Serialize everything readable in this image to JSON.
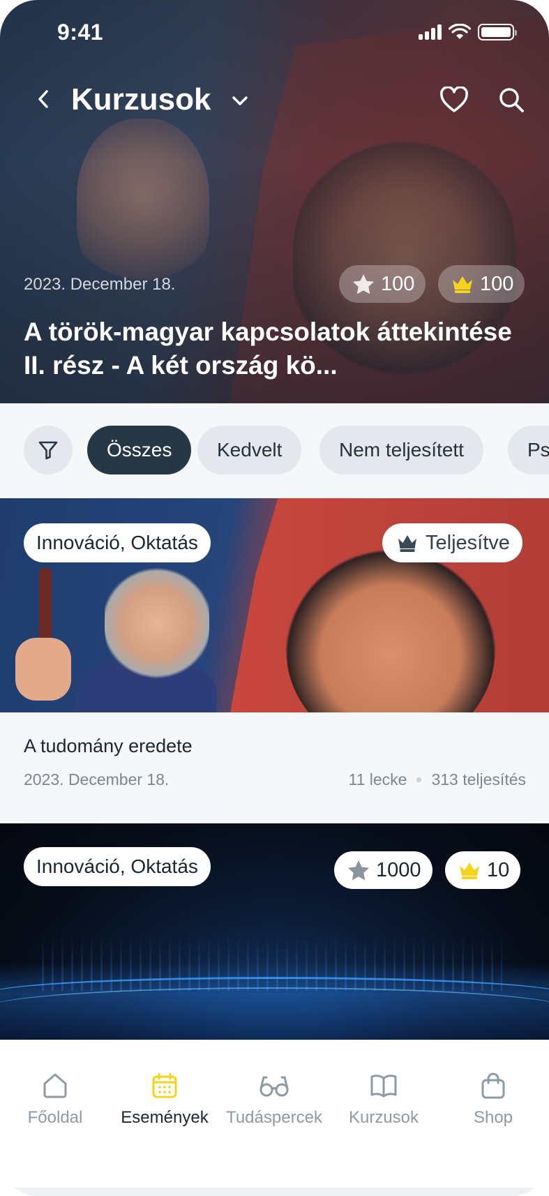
{
  "status_bar": {
    "time": "9:41"
  },
  "header": {
    "title": "Kurzusok"
  },
  "hero": {
    "date": "2023. December 18.",
    "stars": "100",
    "crowns": "100",
    "title": "A török-magyar kapcsolatok áttekintése II. rész - A két ország kö..."
  },
  "filters": {
    "chips": [
      "Összes",
      "Kedvelt",
      "Nem teljesített",
      "Ps"
    ],
    "active": "Összes"
  },
  "cards": [
    {
      "tags": "Innováció, Oktatás",
      "status": "Teljesítve",
      "title": "A tudomány eredete",
      "date": "2023. December 18.",
      "lessons": "11 lecke",
      "completions": "313 teljesítés"
    },
    {
      "tags": "Innováció, Oktatás",
      "stars": "1000",
      "crowns": "10"
    }
  ],
  "tabs": [
    {
      "label": "Főoldal",
      "icon": "home-icon"
    },
    {
      "label": "Események",
      "icon": "calendar-icon"
    },
    {
      "label": "Tudáspercek",
      "icon": "glasses-icon"
    },
    {
      "label": "Kurzusok",
      "icon": "book-icon"
    },
    {
      "label": "Shop",
      "icon": "shopping-bag-icon"
    }
  ],
  "active_tab": "Események",
  "colors": {
    "accent_yellow": "#f5d31b",
    "chip_active": "#263846",
    "chip_bg": "#e4e8ec",
    "muted_text": "#7b8793"
  }
}
